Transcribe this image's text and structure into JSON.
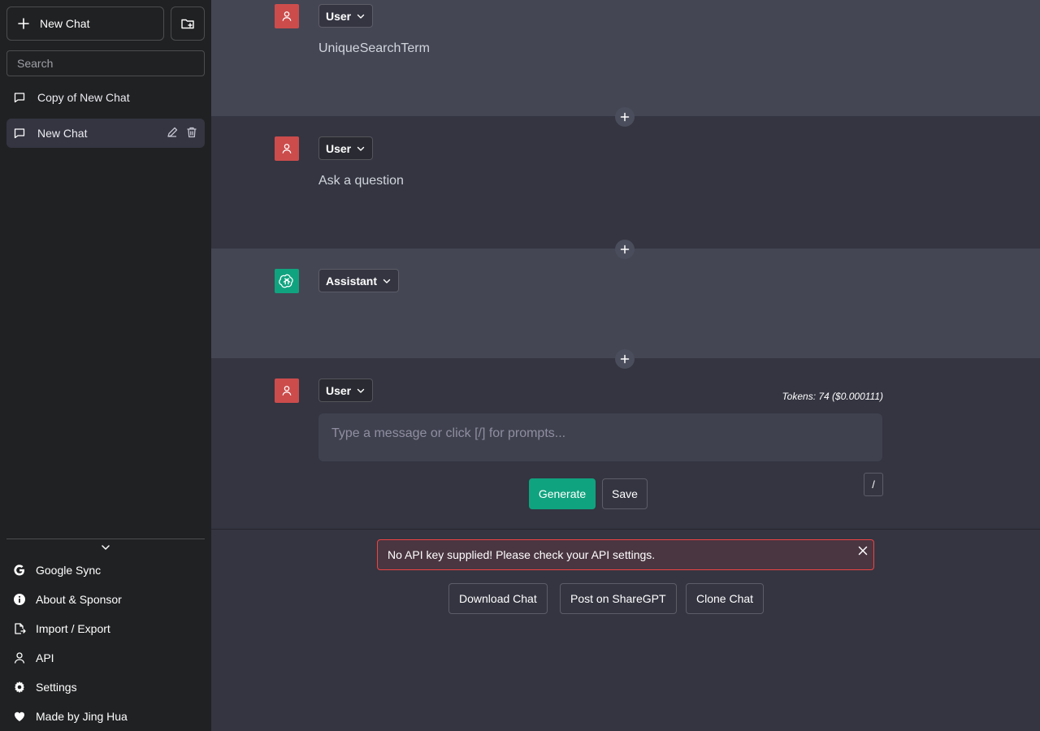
{
  "sidebar": {
    "new_chat_label": "New Chat",
    "search_placeholder": "Search",
    "chats": [
      {
        "title": "Copy of New Chat"
      },
      {
        "title": "New Chat"
      }
    ],
    "menu": [
      {
        "label": "Google Sync",
        "icon": "google-icon"
      },
      {
        "label": "About & Sponsor",
        "icon": "info-icon"
      },
      {
        "label": "Import / Export",
        "icon": "file-export-icon"
      },
      {
        "label": "API",
        "icon": "person-icon"
      },
      {
        "label": "Settings",
        "icon": "gear-icon"
      },
      {
        "label": "Made by Jing Hua",
        "icon": "heart-icon"
      }
    ]
  },
  "messages": [
    {
      "role": "User",
      "content": "UniqueSearchTerm"
    },
    {
      "role": "User",
      "content": "Ask a question"
    },
    {
      "role": "Assistant",
      "content": ""
    }
  ],
  "composer": {
    "role": "User",
    "placeholder": "Type a message or click [/] for prompts...",
    "tokens": "Tokens: 74 ($0.000111)",
    "generate_label": "Generate",
    "save_label": "Save",
    "slash_label": "/"
  },
  "error": {
    "message": "No API key supplied! Please check your API settings."
  },
  "actions": {
    "download": "Download Chat",
    "share": "Post on ShareGPT",
    "clone": "Clone Chat"
  },
  "colors": {
    "sidebar_bg": "#202123",
    "main_bg": "#343541",
    "user_msg_bg": "#444654",
    "user_avatar": "#cc4c4c",
    "assistant_avatar": "#10a37f",
    "generate_button": "#10a37f",
    "error_border": "#ef4444"
  }
}
